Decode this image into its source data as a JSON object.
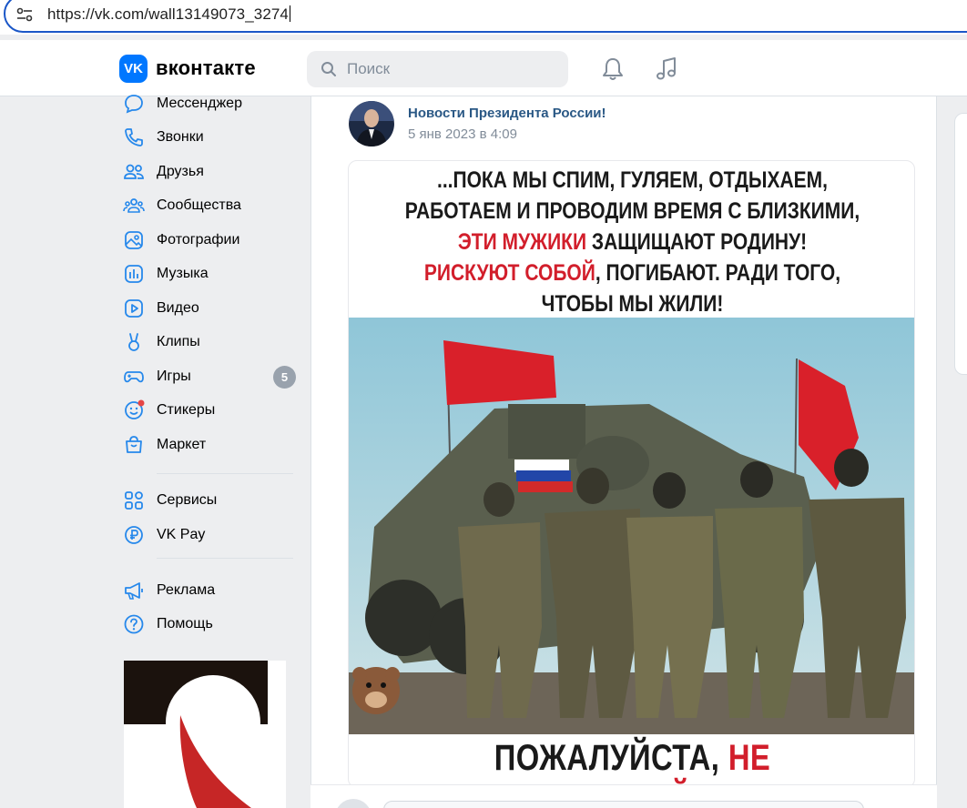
{
  "browser": {
    "url": "https://vk.com/wall13149073_3274"
  },
  "header": {
    "logo_letters": "VK",
    "logo_text": "вконтакте",
    "search_placeholder": "Поиск"
  },
  "sidebar": {
    "items": [
      {
        "label": "Мессенджер",
        "icon": "messenger-icon"
      },
      {
        "label": "Звонки",
        "icon": "phone-icon"
      },
      {
        "label": "Друзья",
        "icon": "friends-icon"
      },
      {
        "label": "Сообщества",
        "icon": "communities-icon"
      },
      {
        "label": "Фотографии",
        "icon": "photos-icon"
      },
      {
        "label": "Музыка",
        "icon": "music-icon"
      },
      {
        "label": "Видео",
        "icon": "video-icon"
      },
      {
        "label": "Клипы",
        "icon": "clips-icon"
      },
      {
        "label": "Игры",
        "icon": "games-icon",
        "badge": "5"
      },
      {
        "label": "Стикеры",
        "icon": "stickers-icon"
      },
      {
        "label": "Маркет",
        "icon": "market-icon"
      },
      {
        "label": "Сервисы",
        "icon": "services-icon"
      },
      {
        "label": "VK Pay",
        "icon": "vkpay-icon"
      },
      {
        "label": "Реклама",
        "icon": "ads-icon"
      },
      {
        "label": "Помощь",
        "icon": "help-icon"
      }
    ]
  },
  "post": {
    "author": "Новости Президента России!",
    "date": "5 янв 2023 в 4:09",
    "poster": {
      "line1": "...ПОКА МЫ СПИМ, ГУЛЯЕМ, ОТДЫХАЕМ,",
      "line2": "РАБОТАЕМ И ПРОВОДИМ ВРЕМЯ С БЛИЗКИМИ,",
      "line3_red": "ЭТИ МУЖИКИ",
      "line3_rest": " ЗАЩИЩАЮТ РОДИНУ!",
      "line4_red": "РИСКУЮТ СОБОЙ",
      "line4_rest": ", ПОГИБАЮТ. РАДИ ТОГО,",
      "line5": "ЧТОБЫ МЫ ЖИЛИ!",
      "footer_black": "ПОЖАЛУЙСТА, ",
      "footer_red": "НЕ ЗАБЫВАЙТЕ"
    }
  },
  "colors": {
    "accent": "#0077ff",
    "link": "#2a5885",
    "poster_red": "#d21e2b",
    "background": "#edeef0"
  }
}
